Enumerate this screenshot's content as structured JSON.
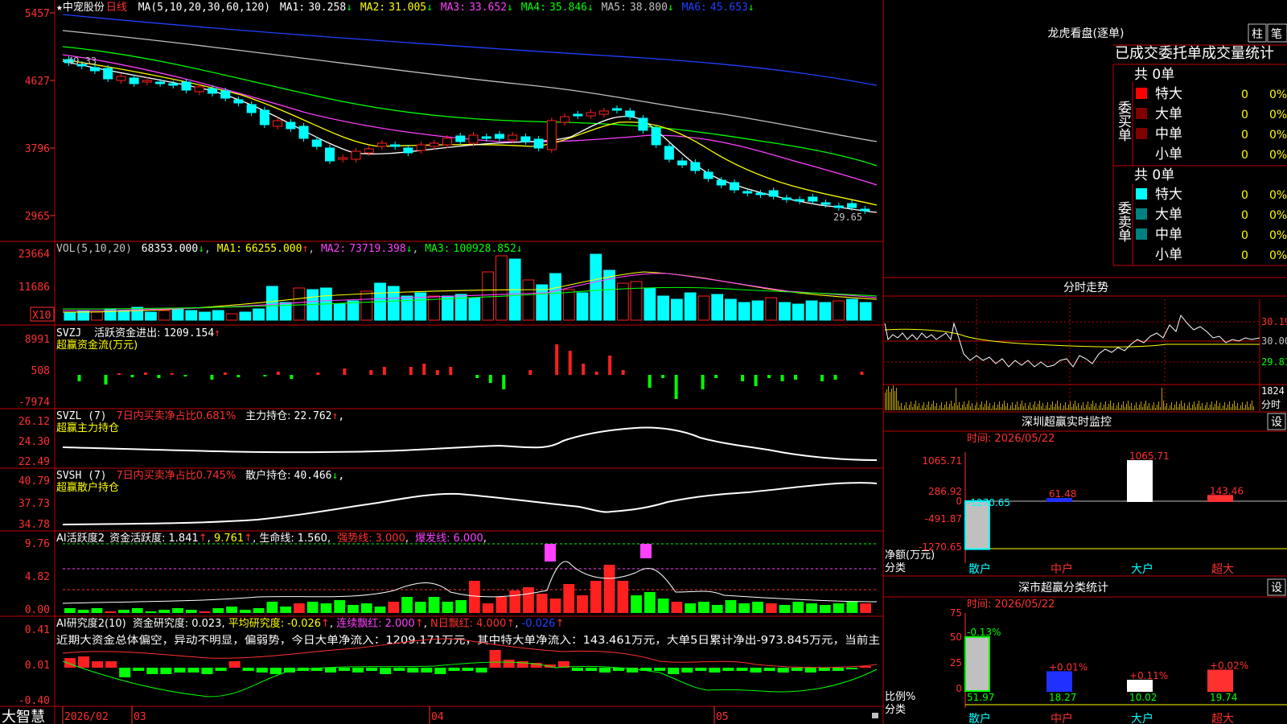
{
  "app": {
    "brand": "大智慧",
    "stock_name": "中宠股份",
    "period": "日线",
    "star": "★"
  },
  "colors": {
    "up": "#ff2020",
    "down": "#00ffff",
    "ma1": "#ffffff",
    "ma2": "#ffff00",
    "ma3": "#ff40ff",
    "ma4": "#00ff00",
    "ma5": "#c0c0c0",
    "ma6": "#2040ff",
    "grid": "#c00000",
    "green": "#00ff00",
    "yellow": "#ffff00"
  },
  "price_panel": {
    "legend_prefix": "MA(5,10,20,30,60,120)",
    "ma": [
      {
        "label": "MA1:",
        "value": "30.258",
        "arrow": "↓"
      },
      {
        "label": "MA2:",
        "value": "31.005",
        "arrow": "↓"
      },
      {
        "label": "MA3:",
        "value": "33.652",
        "arrow": "↓"
      },
      {
        "label": "MA4:",
        "value": "35.846",
        "arrow": "↓"
      },
      {
        "label": "MA5:",
        "value": "38.800",
        "arrow": "↓"
      },
      {
        "label": "MA6:",
        "value": "45.653",
        "arrow": "↓"
      }
    ],
    "y_labels": [
      "5457",
      "4627",
      "3796",
      "2965"
    ],
    "high_note": "49.33",
    "low_note": "29.65"
  },
  "vol_panel": {
    "legend_prefix": "VOL(5,10,20)",
    "value": "68353.000",
    "value_arrow": "↓",
    "ma": [
      {
        "label": "MA1:",
        "value": "66255.000",
        "arrow": "↑"
      },
      {
        "label": "MA2:",
        "value": "73719.398",
        "arrow": "↓"
      },
      {
        "label": "MA3:",
        "value": "100928.852",
        "arrow": "↓"
      }
    ],
    "y_labels": [
      "23664",
      "11686"
    ],
    "unit": "X10"
  },
  "svzj_panel": {
    "line1_prefix": "SVZJ",
    "line1_label": "活跃资金进出:",
    "line1_value": "1209.154",
    "line1_arrow": "↑",
    "line2": "超赢资金流(万元)",
    "y_labels": [
      "8991",
      "508",
      "-7974"
    ]
  },
  "svzl_panel": {
    "prefix": "SVZL (7)",
    "red_label": "7日内买卖净占比0.681%",
    "label": "主力持仓:",
    "value": "22.762",
    "arrow": "↑",
    "line2": "超赢主力持仓",
    "y_labels": [
      "26.12",
      "24.30",
      "22.49"
    ]
  },
  "svsh_panel": {
    "prefix": "SVSH (7)",
    "red_label": "7日内买卖净占比0.745%",
    "label": "散户持仓:",
    "value": "40.466",
    "arrow": "↓",
    "line2": "超赢散户持仓",
    "y_labels": [
      "40.79",
      "37.73",
      "34.78"
    ]
  },
  "ai_panel": {
    "prefix": "AI活跃度2",
    "label1": "资金活跃度:",
    "value1": "1.841",
    "value2": "9.761",
    "label3": "生命线:",
    "value3": "1.560",
    "label4": "强势线:",
    "value4": "3.000",
    "label5": "爆发线:",
    "value5": "6.000",
    "y_labels": [
      "9.76",
      "4.82",
      "0.00"
    ]
  },
  "ai2_panel": {
    "prefix": "AI研究度2(10)",
    "label1": "资金研究度:",
    "value1": "0.023",
    "label2": "平均研究度:",
    "value2": "-0.026",
    "label3": "连续飘红:",
    "value3": "2.000",
    "label4": "N日飘红:",
    "value4": "4.000",
    "value5": "-0.026",
    "comment": "近期大资金总体偏空，异动不明显，偏弱势，今日大单净流入：1209.171万元，其中特大单净流入：143.461万元，大单5日累计净出-973.845万元，当前主",
    "y_labels": [
      "0.41",
      "0.01",
      "-0.40"
    ]
  },
  "x_axis": {
    "labels": [
      "2026/02",
      "03",
      "04",
      "05"
    ]
  },
  "right": {
    "longhu_title": "龙虎看盘(逐单)",
    "tab1": "柱",
    "tab2": "笔",
    "table_header": "已成交委托单成交量统计",
    "buy_side": "委买单",
    "sell_side": "委卖单",
    "buy_total": "共 0单",
    "sell_total": "共 0单",
    "rows": [
      {
        "label": "特大",
        "count": "0",
        "pct": "0%"
      },
      {
        "label": "大单",
        "count": "0",
        "pct": "0%"
      },
      {
        "label": "中单",
        "count": "0",
        "pct": "0%"
      },
      {
        "label": "小单",
        "count": "0",
        "pct": "0%"
      }
    ],
    "intraday_title": "分时走势",
    "intraday_prices": [
      "30.19",
      "30.00",
      "29.81"
    ],
    "intraday_vol": "1824",
    "intraday_unit": "分时",
    "monitor_title": "深圳超赢实时监控",
    "monitor_btn": "设",
    "monitor_time": "时间: 2026/05/22",
    "monitor_y": [
      "1065.71",
      "286.92",
      "0",
      "-491.87",
      "-1270.65"
    ],
    "monitor_axis_label1": "净额(万元)",
    "monitor_axis_label2": "分类",
    "class_title": "深市超赢分类统计",
    "class_btn": "设",
    "class_time": "时间: 2026/05/22",
    "class_y": [
      "75",
      "50",
      "25",
      "0"
    ],
    "class_axis_label1": "比例%",
    "class_axis_label2": "分类"
  },
  "chart_data": [
    {
      "type": "bar",
      "title": "深圳超赢实时监控",
      "categories": [
        "散户",
        "中户",
        "大户",
        "超大"
      ],
      "values": [
        -1270.65,
        61.48,
        1065.71,
        143.46
      ],
      "value_labels": [
        "-1270.65",
        "61.48",
        "1065.71",
        "143.46"
      ],
      "ylabel": "净额(万元)",
      "xlabel": "分类",
      "ylim": [
        -1270.65,
        1065.71
      ]
    },
    {
      "type": "bar",
      "title": "深市超赢分类统计",
      "categories": [
        "散户",
        "中户",
        "大户",
        "超大"
      ],
      "values": [
        51.97,
        18.27,
        10.02,
        19.74
      ],
      "value_labels": [
        "51.97",
        "18.27",
        "10.02",
        "19.74"
      ],
      "changes": [
        "-0.13%",
        "+0.01%",
        "+0.11%",
        "+0.02%"
      ],
      "ylabel": "比例%",
      "xlabel": "分类",
      "ylim": [
        0,
        75
      ]
    }
  ]
}
